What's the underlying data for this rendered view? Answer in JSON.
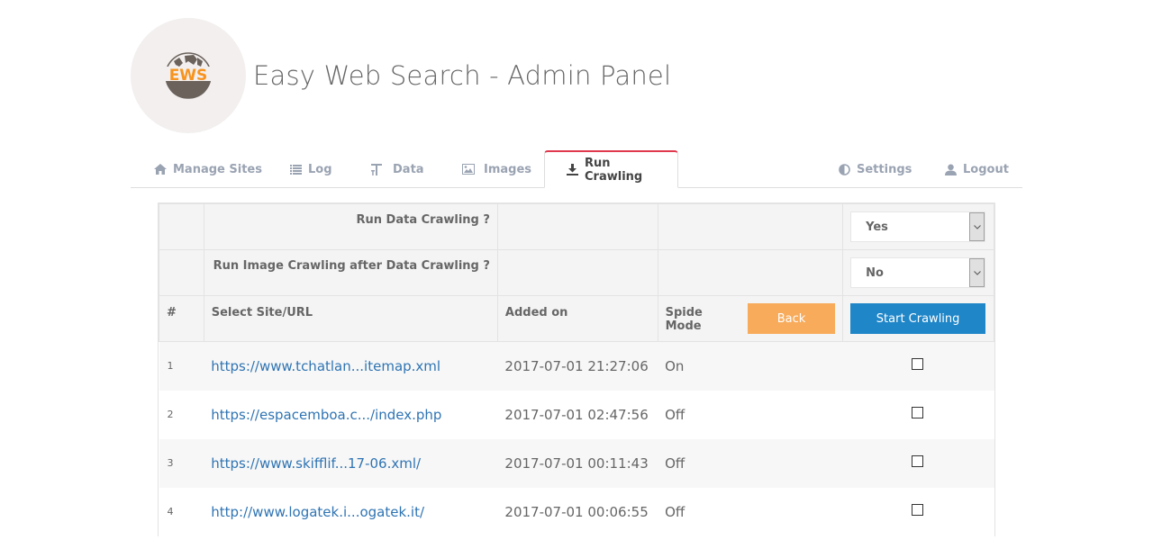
{
  "header": {
    "title": "Easy Web Search - Admin Panel",
    "logo_text": "EWS",
    "logo_icon": "globe-icon"
  },
  "nav": {
    "tabs": [
      {
        "label": "Manage Sites",
        "icon": "home-icon",
        "active": false
      },
      {
        "label": "Log",
        "icon": "list-icon",
        "active": false
      },
      {
        "label": "Data",
        "icon": "text-height-icon",
        "active": false
      },
      {
        "label": "Images",
        "icon": "picture-icon",
        "active": false
      },
      {
        "label": "Run Crawling",
        "icon": "download-icon",
        "active": true
      },
      {
        "label": "Settings",
        "icon": "adjust-icon",
        "active": false
      },
      {
        "label": "Logout",
        "icon": "user-icon",
        "active": false
      }
    ]
  },
  "options": {
    "run_data_crawling_label": "Run Data Crawling ?",
    "run_data_crawling_value": "Yes",
    "run_image_crawling_label": "Run Image Crawling after Data Crawling ?",
    "run_image_crawling_value": "No"
  },
  "table": {
    "headers": {
      "num": "#",
      "site": "Select Site/URL",
      "added": "Added on",
      "mode": "Spide Mode"
    },
    "back_label": "Back",
    "start_label": "Start Crawling",
    "rows": [
      {
        "num": "1",
        "url": "https://www.tchatlan...itemap.xml",
        "added": "2017-07-01 21:27:06",
        "mode": "On",
        "checked": false
      },
      {
        "num": "2",
        "url": "https://espacemboa.c.../index.php",
        "added": "2017-07-01 02:47:56",
        "mode": "Off",
        "checked": false
      },
      {
        "num": "3",
        "url": "https://www.skifflif...17-06.xml/",
        "added": "2017-07-01 00:11:43",
        "mode": "Off",
        "checked": false
      },
      {
        "num": "4",
        "url": "http://www.logatek.i...ogatek.it/",
        "added": "2017-07-01 00:06:55",
        "mode": "Off",
        "checked": false
      }
    ]
  },
  "colors": {
    "accent_tab": "#e0384c",
    "back_button": "#f7ab5b",
    "start_button": "#1f86c8",
    "link": "#2f74b3",
    "logo_orange": "#f7931e",
    "logo_globe": "#6b625c"
  }
}
